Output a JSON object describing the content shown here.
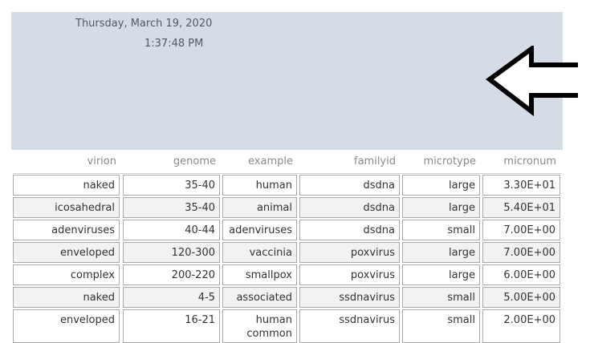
{
  "header": {
    "date": "Thursday, March 19, 2020",
    "time": "1:37:48 PM"
  },
  "columns": [
    "virion",
    "genome",
    "example",
    "familyid",
    "microtype",
    "micronum"
  ],
  "rows": [
    [
      "naked",
      "35-40",
      "human",
      "dsdna",
      "large",
      "3.30E+01"
    ],
    [
      "icosahedral",
      "35-40",
      "animal",
      "dsdna",
      "large",
      "5.40E+01"
    ],
    [
      "adenviruses",
      "40-44",
      "adenviruses",
      "dsdna",
      "small",
      "7.00E+00"
    ],
    [
      "enveloped",
      "120-300",
      "vaccinia",
      "poxvirus",
      "large",
      "7.00E+00"
    ],
    [
      "complex",
      "200-220",
      "smallpox",
      "poxvirus",
      "large",
      "6.00E+00"
    ],
    [
      "naked",
      "4-5",
      "associated",
      "ssdnavirus",
      "small",
      "5.00E+00"
    ],
    [
      "enveloped",
      "16-21",
      "human\ncommon",
      "ssdnavirus",
      "small",
      "2.00E+00"
    ]
  ],
  "icons": {
    "arrow": "left-arrow-icon"
  },
  "colors": {
    "header_bg": "#d6dce6",
    "alt_row_bg": "#f2f2f2",
    "border": "#a9a9a9"
  }
}
